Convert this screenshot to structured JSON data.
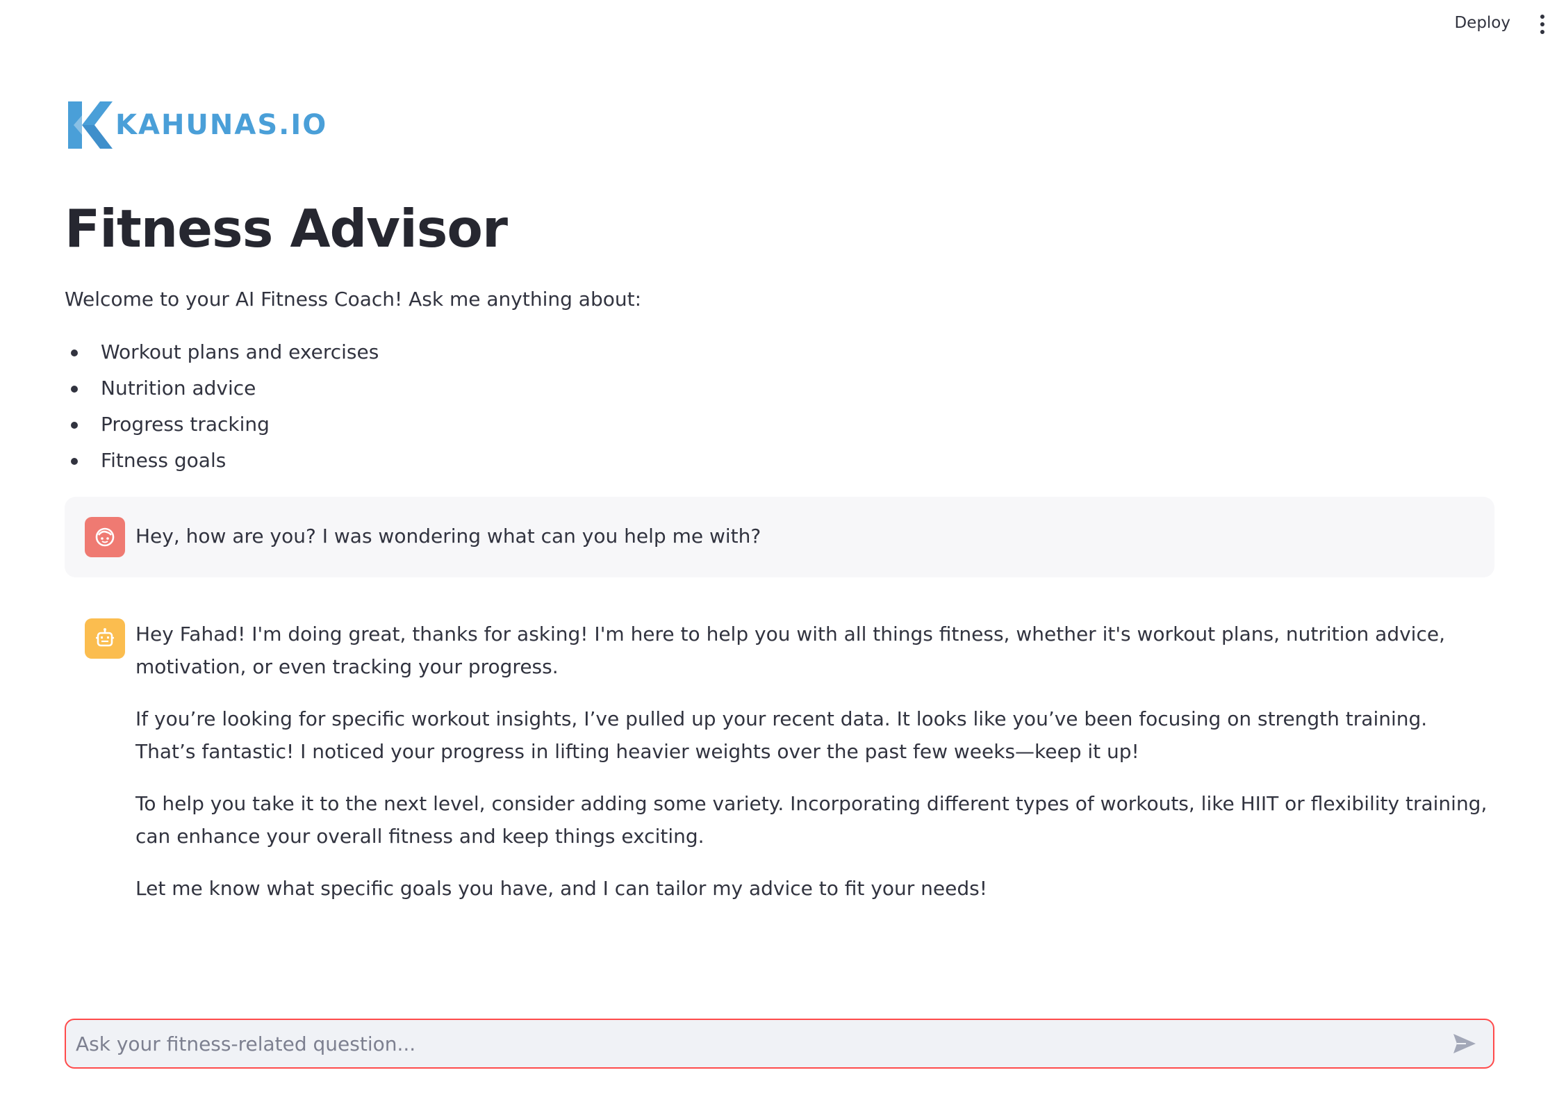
{
  "toolbar": {
    "deploy_label": "Deploy",
    "menu_icon": "more-vertical-icon"
  },
  "logo": {
    "text": "KAHUNAS.IO",
    "color": "#4a9fd8",
    "icon": "kahunas-k-logo"
  },
  "page": {
    "title": "Fitness Advisor",
    "intro": "Welcome to your AI Fitness Coach! Ask me anything about:",
    "topics": [
      "Workout plans and exercises",
      "Nutrition advice",
      "Progress tracking",
      "Fitness goals"
    ]
  },
  "chat": {
    "messages": [
      {
        "role": "user",
        "avatar_icon": "user-face-icon",
        "avatar_color": "#ef7a72",
        "text": "Hey, how are you? I was wondering what can you help me with?"
      },
      {
        "role": "assistant",
        "avatar_icon": "robot-icon",
        "avatar_color": "#fbbd4f",
        "paragraphs": [
          "Hey Fahad! I'm doing great, thanks for asking! I'm here to help you with all things fitness, whether it's workout plans, nutrition advice, motivation, or even tracking your progress.",
          "If you’re looking for specific workout insights, I’ve pulled up your recent data. It looks like you’ve been focusing on strength training. That’s fantastic! I noticed your progress in lifting heavier weights over the past few weeks—keep it up!",
          "To help you take it to the next level, consider adding some variety. Incorporating different types of workouts, like HIIT or flexibility training, can enhance your overall fitness and keep things exciting.",
          "Let me know what specific goals you have, and I can tailor my advice to fit your needs!"
        ]
      }
    ]
  },
  "input": {
    "placeholder": "Ask your fitness-related question...",
    "value": "",
    "send_icon": "send-icon",
    "focus_color": "#ff4b4b"
  }
}
